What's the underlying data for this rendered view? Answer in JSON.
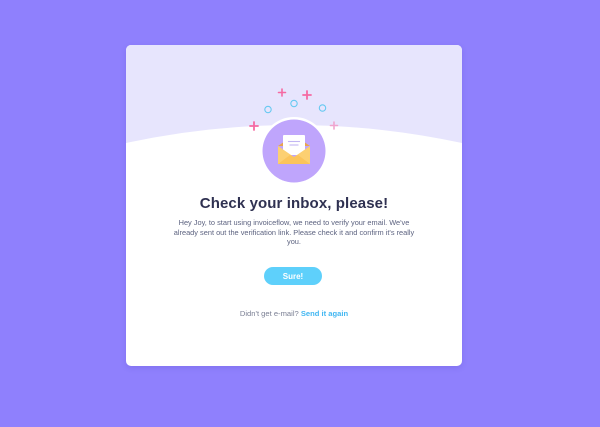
{
  "dialog": {
    "title": "Check your inbox, please!",
    "message": "Hey Joy, to start using invoiceflow, we need to verify your email. We've already sent out the verification link. Please check it and confirm it's really you.",
    "confirm_label": "Sure!",
    "resend_prompt": "Didn't get e-mail?",
    "resend_link": "Send it again"
  },
  "icons": {
    "main": "envelope-icon",
    "decorations": [
      "plus-icon",
      "circle-icon"
    ]
  },
  "colors": {
    "page_background": "#8f80fd",
    "card_background": "#ffffff",
    "card_header_background": "#e7e5fd",
    "icon_circle": "#bfa5fc",
    "envelope": "#fcd072",
    "button": "#5ed0fb",
    "link": "#42b7f2",
    "title_text": "#2f3151",
    "plus_decoration": "#f56aa2",
    "circle_decoration": "#67c9f1"
  }
}
